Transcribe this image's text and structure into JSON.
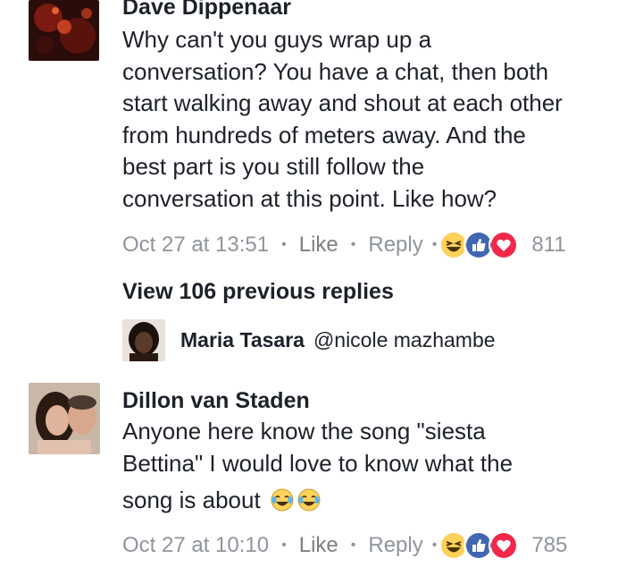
{
  "comments": [
    {
      "author": "Dave Dippenaar",
      "text_lines": [
        "Why can't you guys wrap up a",
        "conversation? You have a chat, then both",
        "start walking away and shout at each other",
        "from hundreds of meters away. And the",
        "best part is you still follow the",
        "conversation at this point. Like how?"
      ],
      "time": "Oct 27 at 13:51",
      "like_label": "Like",
      "reply_label": "Reply",
      "reaction_icons": [
        "haha-icon",
        "like-icon",
        "love-icon"
      ],
      "reaction_count": "811"
    },
    {
      "author": "Dillon van Staden",
      "text_lines": [
        "Anyone here know the song \"siesta",
        "Bettina\" I would love to know what the",
        "song is about"
      ],
      "time": "Oct 27 at 10:10",
      "like_label": "Like",
      "reply_label": "Reply",
      "reaction_icons": [
        "haha-icon",
        "like-icon",
        "love-icon"
      ],
      "reaction_count": "785"
    }
  ],
  "view_previous": "View 106 previous replies",
  "reply": {
    "author": "Maria Tasara",
    "text": "@nicole mazhambe"
  },
  "colors": {
    "like_blue": "#4267b2",
    "love_red": "#f0284a",
    "haha_yellow": "#fdd15a",
    "meta_gray": "#90949c"
  }
}
